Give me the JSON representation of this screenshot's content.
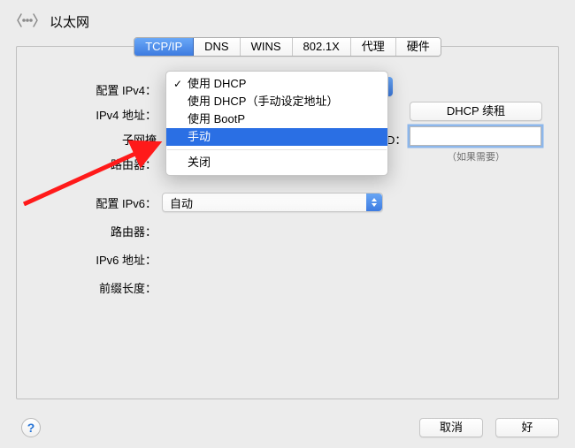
{
  "header": {
    "title": "以太网"
  },
  "tabs": [
    "TCP/IP",
    "DNS",
    "WINS",
    "802.1X",
    "代理",
    "硬件"
  ],
  "active_tab": 0,
  "labels": {
    "configure_ipv4": "配置 IPv4：",
    "ipv4_address": "IPv4 地址：",
    "subnet_prefix": "子网掩",
    "router_v4": "路由器：",
    "configure_ipv6": "配置 IPv6：",
    "router_v6": "路由器：",
    "ipv6_address": "IPv6 地址：",
    "prefix_length": "前缀长度："
  },
  "dropdown": {
    "items": [
      "使用 DHCP",
      "使用 DHCP（手动设定地址）",
      "使用 BootP",
      "手动",
      "关闭"
    ],
    "checked_index": 0,
    "selected_index": 3
  },
  "right": {
    "renew_button": "DHCP 续租",
    "cut_label": "D：",
    "client_id_value": "",
    "client_id_placeholder": "",
    "hint": "（如果需要）"
  },
  "ipv6_select": {
    "value": "自动"
  },
  "footer": {
    "help": "?",
    "cancel": "取消",
    "ok": "好"
  }
}
